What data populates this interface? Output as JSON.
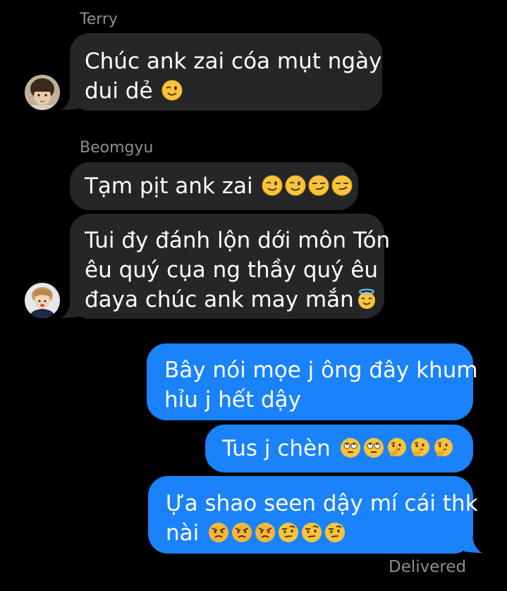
{
  "thread": {
    "groups": [
      {
        "sender": "Terry",
        "messages": [
          {
            "lines": [
              "Chúc ank zai cóa mụt ngày",
              "dui dẻ"
            ],
            "emoji_names": [
              "winking-face-emoji"
            ]
          }
        ]
      },
      {
        "sender": "Beomgyu",
        "messages": [
          {
            "lines": [
              "Tạm pịt ank zai"
            ],
            "emoji_names": [
              "winking-face-emoji",
              "winking-face-emoji",
              "smirking-face-emoji",
              "smirking-face-emoji"
            ]
          },
          {
            "lines": [
              "Tui đy đánh lộn dới môn Tón",
              "êu quý cụa ng thầy quý êu",
              "đaya chúc ank may mắn"
            ],
            "emoji_names": [
              "smiling-face-with-halo-emoji"
            ]
          }
        ]
      }
    ],
    "outgoing": [
      {
        "lines": [
          "Bây nói mọe j ông đây khum",
          "hỉu j hết dậy"
        ]
      },
      {
        "lines": [
          "Tus j chèn"
        ],
        "emoji_names": [
          "face-with-rolling-eyes-emoji",
          "face-with-rolling-eyes-emoji",
          "thinking-face-emoji",
          "thinking-face-emoji",
          "thinking-face-emoji"
        ]
      },
      {
        "lines": [
          "Ựa shao seen dậy mí cái thk",
          "nài"
        ],
        "emoji_names": [
          "angry-face-emoji",
          "angry-face-emoji",
          "angry-face-emoji",
          "face-with-raised-eyebrow-emoji",
          "face-with-raised-eyebrow-emoji",
          "face-with-raised-eyebrow-emoji"
        ]
      }
    ],
    "status": "Delivered"
  },
  "colors": {
    "background": "#000000",
    "incoming_bubble": "#262628",
    "outgoing_bubble": "#1a82fb",
    "meta_text": "#8e8e93"
  }
}
